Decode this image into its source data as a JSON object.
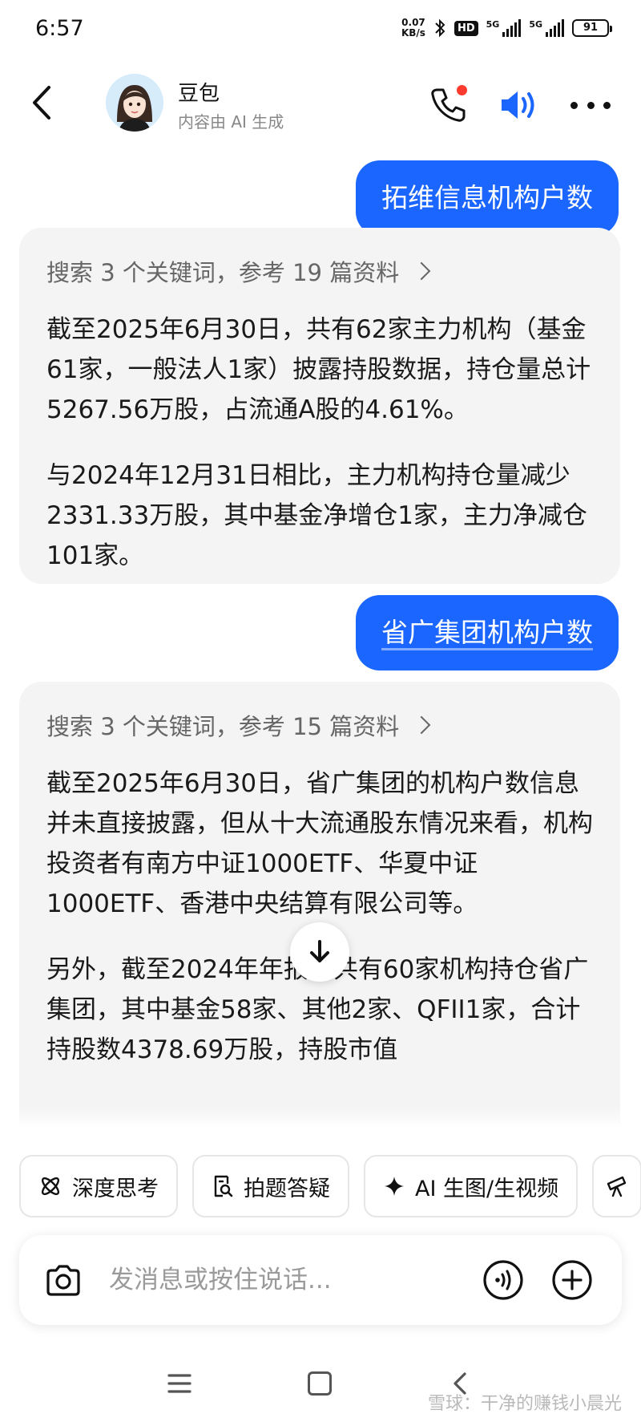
{
  "status_bar": {
    "time": "6:57",
    "net_speed_value": "0.07",
    "net_speed_unit": "KB/s",
    "hd_label": "HD",
    "signal1_label": "5G",
    "signal2_label": "5G",
    "battery": "91"
  },
  "header": {
    "bot_name": "豆包",
    "subtitle": "内容由 AI 生成",
    "call_dot_color": "#ff3b30",
    "speaker_color": "#1a66ff"
  },
  "messages": [
    {
      "role": "user",
      "text": "拓维信息机构户数"
    },
    {
      "role": "bot",
      "search_summary": "搜索 3 个关键词，参考 19 篇资料",
      "paragraphs": [
        "截至2025年6月30日，共有62家主力机构（基金61家，一般法人1家）披露持股数据，持仓量总计5267.56万股，占流通A股的4.61%。",
        "与2024年12月31日相比，主力机构持仓量减少2331.33万股，其中基金净增仓1家，主力净减仓101家。"
      ]
    },
    {
      "role": "user",
      "text": "省广集团机构户数"
    },
    {
      "role": "bot",
      "search_summary": "搜索 3 个关键词，参考 15 篇资料",
      "paragraphs": [
        "截至2025年6月30日，省广集团的机构户数信息并未直接披露，但从十大流通股东情况来看，机构投资者有南方中证1000ETF、华夏中证1000ETF、香港中央结算有限公司等。",
        "另外，截至2024年年报，共有60家机构持仓省广集团，其中基金58家、其他2家、QFII1家，合计持股数4378.69万股，持股市值"
      ]
    }
  ],
  "quick_actions": [
    {
      "label": "深度思考",
      "icon": "atom-icon"
    },
    {
      "label": "拍题答疑",
      "icon": "doc-search-icon"
    },
    {
      "label": "AI 生图/生视频",
      "icon": "sparkle-icon"
    },
    {
      "label": "",
      "icon": "telescope-icon"
    }
  ],
  "input": {
    "placeholder": "发消息或按住说话..."
  },
  "watermark": "雪球：干净的赚钱小晨光",
  "colors": {
    "accent": "#1a66ff",
    "bot_bubble": "#f4f4f5"
  }
}
